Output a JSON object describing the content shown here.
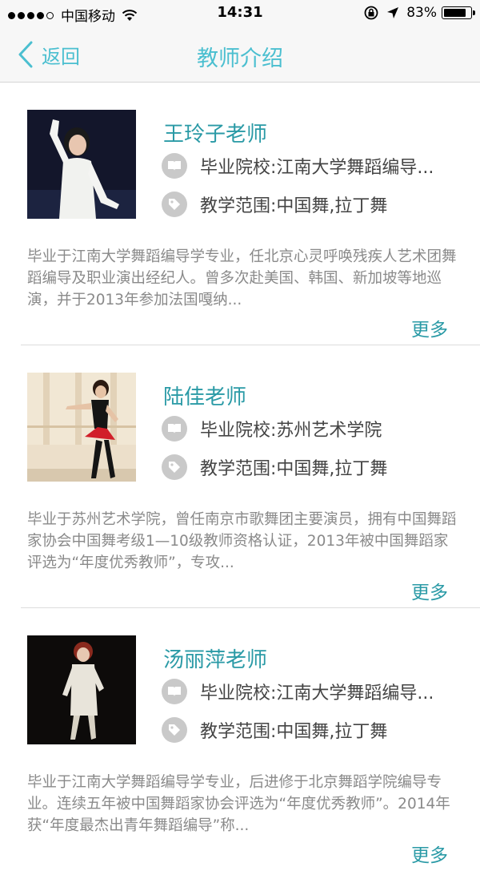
{
  "status_bar": {
    "carrier": "中国移动",
    "time": "14:31",
    "battery_percent": "83%",
    "battery_level": 0.83,
    "icons": [
      "signal-dots",
      "wifi-icon",
      "lock-rotation-icon",
      "location-arrow-icon",
      "battery-icon"
    ]
  },
  "nav": {
    "back_label": "返回",
    "title": "教师介绍"
  },
  "teachers": [
    {
      "name": "王玲子老师",
      "school": "毕业院校:江南大学舞蹈编导...",
      "scope": "教学范围:中国舞,拉丁舞",
      "desc": "毕业于江南大学舞蹈编导学专业，任北京心灵呼唤残疾人艺术团舞蹈编导及职业演出经纪人。曾多次赴美国、韩国、新加坡等地巡演，并于2013年参加法国嘎纳...",
      "more": "更多"
    },
    {
      "name": "陆佳老师",
      "school": "毕业院校:苏州艺术学院",
      "scope": "教学范围:中国舞,拉丁舞",
      "desc": "毕业于苏州艺术学院，曾任南京市歌舞团主要演员，拥有中国舞蹈家协会中国舞考级1—10级教师资格认证，2013年被中国舞蹈家评选为“年度优秀教师”，专攻...",
      "more": "更多"
    },
    {
      "name": "汤丽萍老师",
      "school": "毕业院校:江南大学舞蹈编导...",
      "scope": "教学范围:中国舞,拉丁舞",
      "desc": "毕业于江南大学舞蹈编导学专业，后进修于北京舞蹈学院编导专业。连续五年被中国舞蹈家协会评选为“年度优秀教师”。2014年获“年度最杰出青年舞蹈编导”称...",
      "more": "更多"
    }
  ]
}
